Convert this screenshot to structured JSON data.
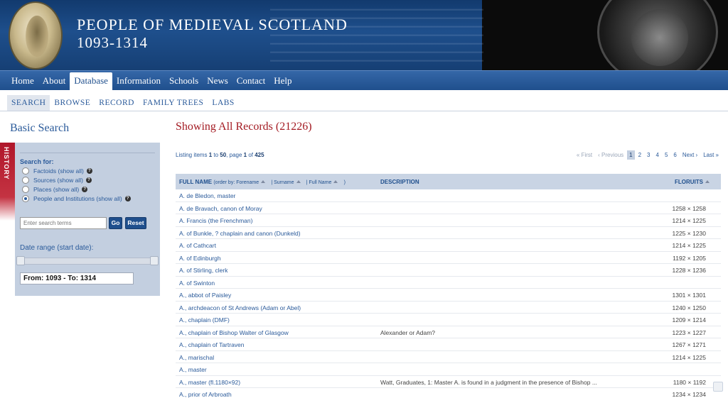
{
  "banner": {
    "title": "PEOPLE OF MEDIEVAL SCOTLAND",
    "years": "1093-1314"
  },
  "main_nav": [
    {
      "label": "Home",
      "active": false
    },
    {
      "label": "About",
      "active": false
    },
    {
      "label": "Database",
      "active": true
    },
    {
      "label": "Information",
      "active": false
    },
    {
      "label": "Schools",
      "active": false
    },
    {
      "label": "News",
      "active": false
    },
    {
      "label": "Contact",
      "active": false
    },
    {
      "label": "Help",
      "active": false
    }
  ],
  "sub_nav": [
    {
      "label": "SEARCH",
      "active": true
    },
    {
      "label": "BROWSE",
      "active": false
    },
    {
      "label": "RECORD",
      "active": false
    },
    {
      "label": "FAMILY TREES",
      "active": false
    },
    {
      "label": "LABS",
      "active": false
    }
  ],
  "sidebar": {
    "heading": "Basic Search",
    "history_tab": "HISTORY",
    "search_for_label": "Search for:",
    "options": [
      {
        "label": "Factoids (show all)",
        "checked": false
      },
      {
        "label": "Sources (show all)",
        "checked": false
      },
      {
        "label": "Places (show all)",
        "checked": false
      },
      {
        "label": "People and Institutions (show all)",
        "checked": true
      }
    ],
    "search_placeholder": "Enter search terms",
    "go_label": "Go",
    "reset_label": "Reset",
    "date_range_label": "Date range (start date):",
    "date_range_value": "From: 1093 - To: 1314"
  },
  "main": {
    "heading": "Showing All Records (21226)",
    "listing": {
      "prefix": "Listing items ",
      "from": "1",
      "to_word": " to ",
      "to": "50",
      "page_word": ", page ",
      "page": "1",
      "of_word": " of ",
      "total_pages": "425"
    },
    "pager": {
      "first": "« First",
      "previous": "‹ Previous",
      "pages": [
        "1",
        "2",
        "3",
        "4",
        "5",
        "6"
      ],
      "current": "1",
      "next": "Next ›",
      "last": "Last »"
    },
    "columns": {
      "full_name": "FULL NAME",
      "order_by": "(order by: Forename",
      "surname": "| Surname",
      "full_name_sort": "| Full Name",
      "close_paren": ")",
      "description": "DESCRIPTION",
      "floruits": "FLORUITS"
    },
    "rows": [
      {
        "name": "A. de Bledon, master",
        "description": "",
        "floruits": ""
      },
      {
        "name": "A. de Bravach, canon of Moray",
        "description": "",
        "floruits": "1258 × 1258"
      },
      {
        "name": "A. Francis (the Frenchman)",
        "description": "",
        "floruits": "1214 × 1225"
      },
      {
        "name": "A. of Bunkle, ? chaplain and canon (Dunkeld)",
        "description": "",
        "floruits": "1225 × 1230"
      },
      {
        "name": "A. of Cathcart",
        "description": "",
        "floruits": "1214 × 1225"
      },
      {
        "name": "A. of Edinburgh",
        "description": "",
        "floruits": "1192 × 1205"
      },
      {
        "name": "A. of Stirling, clerk",
        "description": "",
        "floruits": "1228 × 1236"
      },
      {
        "name": "A. of Swinton",
        "description": "",
        "floruits": ""
      },
      {
        "name": "A., abbot of Paisley",
        "description": "",
        "floruits": "1301 × 1301"
      },
      {
        "name": "A., archdeacon of St Andrews (Adam or Abel)",
        "description": "",
        "floruits": "1240 × 1250"
      },
      {
        "name": "A., chaplain (DMF)",
        "description": "",
        "floruits": "1209 × 1214"
      },
      {
        "name": "A., chaplain of Bishop Walter of Glasgow",
        "description": "Alexander or Adam?",
        "floruits": "1223 × 1227"
      },
      {
        "name": "A., chaplain of Tartraven",
        "description": "",
        "floruits": "1267 × 1271"
      },
      {
        "name": "A., marischal",
        "description": "",
        "floruits": "1214 × 1225"
      },
      {
        "name": "A., master",
        "description": "",
        "floruits": ""
      },
      {
        "name": "A., master (fl.1180×92)",
        "description": "Watt, Graduates, 1: Master A. is found in a judgment in the presence of Bishop ...",
        "floruits": "1180 × 1192"
      },
      {
        "name": "A., prior of Arbroath",
        "description": "",
        "floruits": "1234 × 1234"
      }
    ]
  }
}
